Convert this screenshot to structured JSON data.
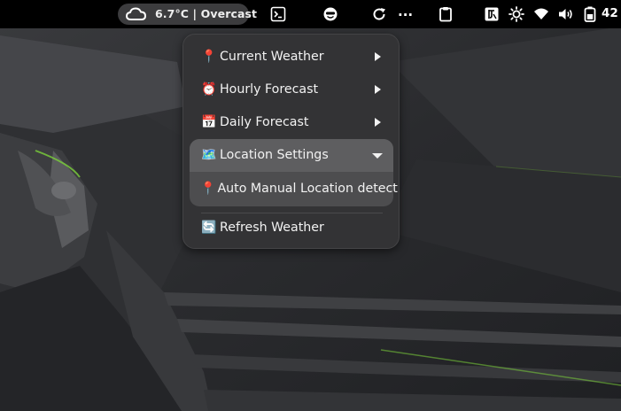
{
  "topbar": {
    "weather_indicator": {
      "icon": "cloud-icon",
      "text": "6.7°C | Overcast"
    },
    "terminal_icon": "terminal-icon",
    "face_icon": "emoji-face-icon",
    "refresh_icon": "refresh-icon",
    "more_label": "...",
    "clipboard_icon": "clipboard-icon",
    "system_icons": [
      "input-method-icon",
      "brightness-icon",
      "wifi-icon",
      "volume-icon",
      "battery-icon"
    ],
    "battery_percent": "42"
  },
  "menu": {
    "items": [
      {
        "emoji": "📍",
        "label": "Current Weather",
        "has_submenu": true
      },
      {
        "emoji": "⏰",
        "label": "Hourly Forecast",
        "has_submenu": true
      },
      {
        "emoji": "📅",
        "label": "Daily Forecast",
        "has_submenu": true
      },
      {
        "emoji": "🗺️",
        "label": "Location Settings",
        "expanded": true
      },
      {
        "emoji": "📍",
        "label": "Auto Manual Location detect"
      },
      {
        "emoji": "🔄",
        "label": "Refresh Weather"
      }
    ]
  },
  "colors": {
    "topbar": "#000000",
    "menu_bg": "#333335",
    "section_header": "#5e5e60",
    "submenu_bg": "#4d4d4f",
    "accent_green": "#7bd13a"
  }
}
